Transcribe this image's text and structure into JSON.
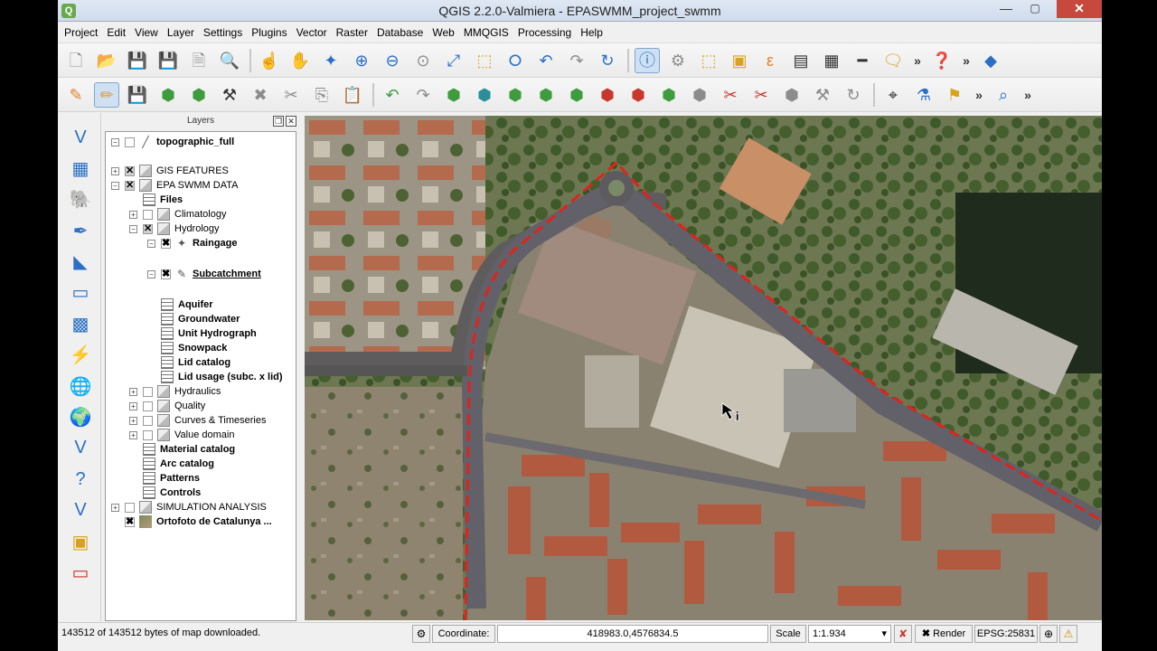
{
  "window": {
    "title": "QGIS 2.2.0-Valmiera - EPASWMM_project_swmm",
    "app_icon": "Q",
    "min_glyph": "—",
    "max_glyph": "▢",
    "close_glyph": "✕"
  },
  "menu": [
    "Project",
    "Edit",
    "View",
    "Layer",
    "Settings",
    "Plugins",
    "Vector",
    "Raster",
    "Database",
    "Web",
    "MMQGIS",
    "Processing",
    "Help"
  ],
  "layers_panel": {
    "title": "Layers",
    "float_glyph": "❐",
    "close_glyph": "✕",
    "tree": [
      {
        "label": "topographic_full",
        "bold": true,
        "indent": 0,
        "expander": "−",
        "check": "",
        "icon": "╱"
      },
      {
        "label": "GIS FEATURES",
        "bold": false,
        "indent": 0,
        "expander": "+",
        "check": "✕",
        "icon": ""
      },
      {
        "label": "EPA SWMM DATA",
        "bold": false,
        "indent": 0,
        "expander": "−",
        "check": "✕",
        "icon": ""
      },
      {
        "label": "Files",
        "bold": true,
        "indent": 1,
        "expander": "",
        "check": "",
        "icon": "table"
      },
      {
        "label": "Climatology",
        "bold": false,
        "indent": 1,
        "expander": "+",
        "check": "",
        "icon": ""
      },
      {
        "label": "Hydrology",
        "bold": false,
        "indent": 1,
        "expander": "−",
        "check": "✕",
        "icon": ""
      },
      {
        "label": "Raingage",
        "bold": true,
        "indent": 2,
        "expander": "−",
        "check": "✖",
        "icon": "✦"
      },
      {
        "label": "Subcatchment",
        "bold": true,
        "indent": 2,
        "expander": "−",
        "check": "✖",
        "icon": "✎"
      },
      {
        "label": "Aquifer",
        "bold": true,
        "indent": 2,
        "expander": "",
        "check": "",
        "icon": "table"
      },
      {
        "label": "Groundwater",
        "bold": true,
        "indent": 2,
        "expander": "",
        "check": "",
        "icon": "table"
      },
      {
        "label": "Unit Hydrograph",
        "bold": true,
        "indent": 2,
        "expander": "",
        "check": "",
        "icon": "table"
      },
      {
        "label": "Snowpack",
        "bold": true,
        "indent": 2,
        "expander": "",
        "check": "",
        "icon": "table"
      },
      {
        "label": "Lid catalog",
        "bold": true,
        "indent": 2,
        "expander": "",
        "check": "",
        "icon": "table"
      },
      {
        "label": "Lid usage (subc. x lid)",
        "bold": true,
        "indent": 2,
        "expander": "",
        "check": "",
        "icon": "table"
      },
      {
        "label": "Hydraulics",
        "bold": false,
        "indent": 1,
        "expander": "+",
        "check": "",
        "icon": ""
      },
      {
        "label": "Quality",
        "bold": false,
        "indent": 1,
        "expander": "+",
        "check": "",
        "icon": ""
      },
      {
        "label": "Curves & Timeseries",
        "bold": false,
        "indent": 1,
        "expander": "+",
        "check": "",
        "icon": ""
      },
      {
        "label": "Value domain",
        "bold": false,
        "indent": 1,
        "expander": "+",
        "check": "",
        "icon": ""
      },
      {
        "label": "Material catalog",
        "bold": true,
        "indent": 1,
        "expander": "",
        "check": "",
        "icon": "table"
      },
      {
        "label": "Arc catalog",
        "bold": true,
        "indent": 1,
        "expander": "",
        "check": "",
        "icon": "table"
      },
      {
        "label": "Patterns",
        "bold": true,
        "indent": 1,
        "expander": "",
        "check": "",
        "icon": "table"
      },
      {
        "label": "Controls",
        "bold": true,
        "indent": 1,
        "expander": "",
        "check": "",
        "icon": "table"
      },
      {
        "label": "SIMULATION ANALYSIS",
        "bold": false,
        "indent": 0,
        "expander": "+",
        "check": "",
        "icon": ""
      },
      {
        "label": "Ortofoto de Catalunya ...",
        "bold": true,
        "indent": 0,
        "expander": "",
        "check": "✖",
        "icon": "raster"
      }
    ]
  },
  "status": {
    "message": "143512 of 143512 bytes of map downloaded.",
    "coordinate_label": "Coordinate:",
    "coordinate_value": "418983.0,4576834.5",
    "scale_label": "Scale",
    "scale_value": "1:1.934",
    "render_label": "Render",
    "render_check": "✖",
    "crs": "EPSG:25831",
    "globe_glyph": "⊕",
    "warning_glyph": "⚠",
    "mouse_glyph": "⚙",
    "dropdown_glyph": "▾",
    "stop_glyph": "✘"
  }
}
